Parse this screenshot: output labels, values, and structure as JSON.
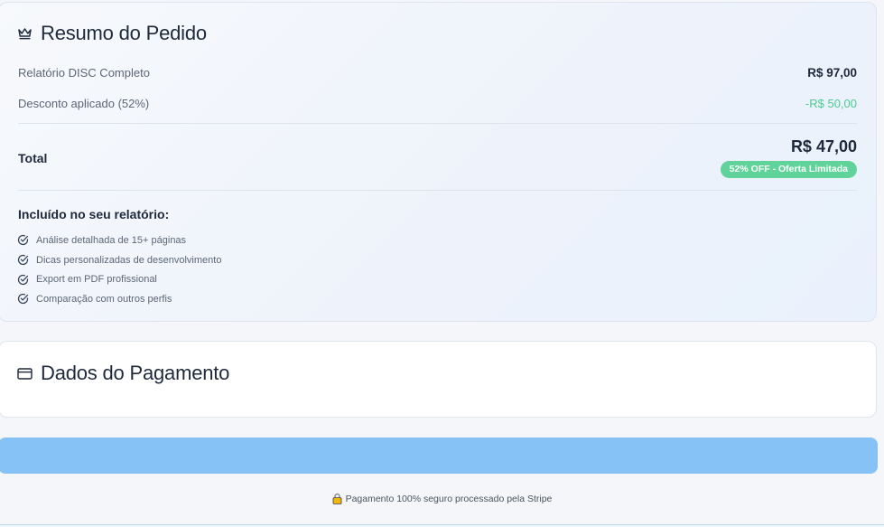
{
  "summary": {
    "title": "Resumo do Pedido",
    "icon": "crown-icon",
    "items": [
      {
        "label": "Relatório DISC Completo",
        "value": "R$ 97,00"
      },
      {
        "label": "Desconto aplicado (52%)",
        "value": "-R$ 50,00"
      }
    ],
    "total_label": "Total",
    "total_value": "R$ 47,00",
    "offer_badge": "52% OFF - Oferta Limitada",
    "included_title": "Incluído no seu relatório:",
    "features": [
      "Análise detalhada de 15+ páginas",
      "Dicas personalizadas de desenvolvimento",
      "Export em PDF profissional",
      "Comparação com outros perfis"
    ],
    "feature_icon": "check-circle-icon"
  },
  "payment": {
    "title": "Dados do Pagamento",
    "icon": "credit-card-icon"
  },
  "pay_button": {
    "label": ""
  },
  "secure_note": {
    "text": "Pagamento 100% seguro processado pela Stripe",
    "icon": "lock-icon"
  },
  "colors": {
    "accent_green": "#5fd39a",
    "discount_green": "#4ccb8f",
    "pay_button": "#86c2f6",
    "text_dark": "#1e293b",
    "text_muted": "#5b6677"
  }
}
